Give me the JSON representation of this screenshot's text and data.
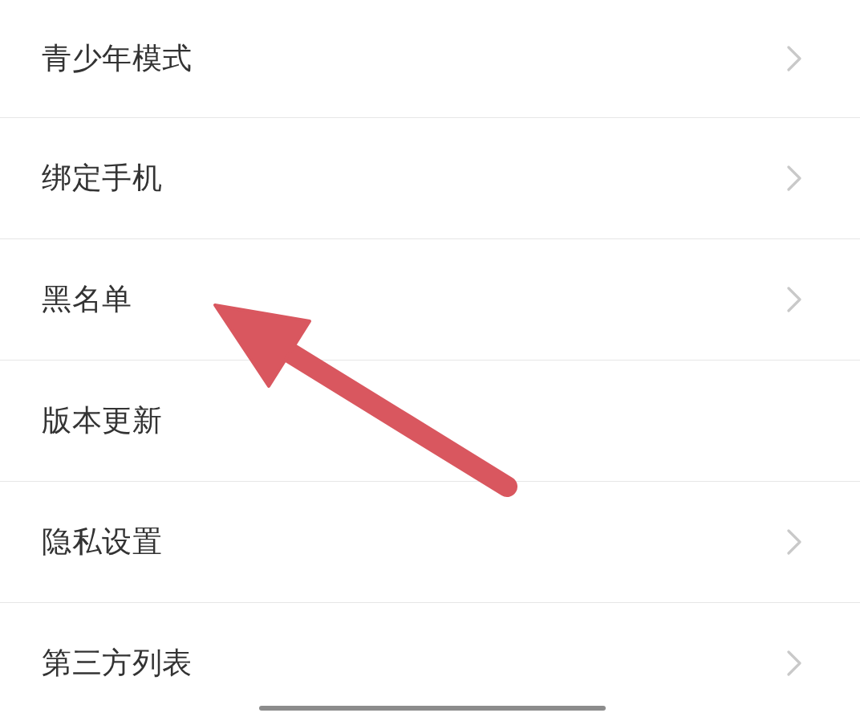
{
  "settings_list": [
    {
      "label": "青少年模式",
      "chevron": true
    },
    {
      "label": "绑定手机",
      "chevron": true
    },
    {
      "label": "黑名单",
      "chevron": true
    },
    {
      "label": "版本更新",
      "chevron": false
    },
    {
      "label": "隐私设置",
      "chevron": true
    },
    {
      "label": "第三方列表",
      "chevron": true
    }
  ]
}
